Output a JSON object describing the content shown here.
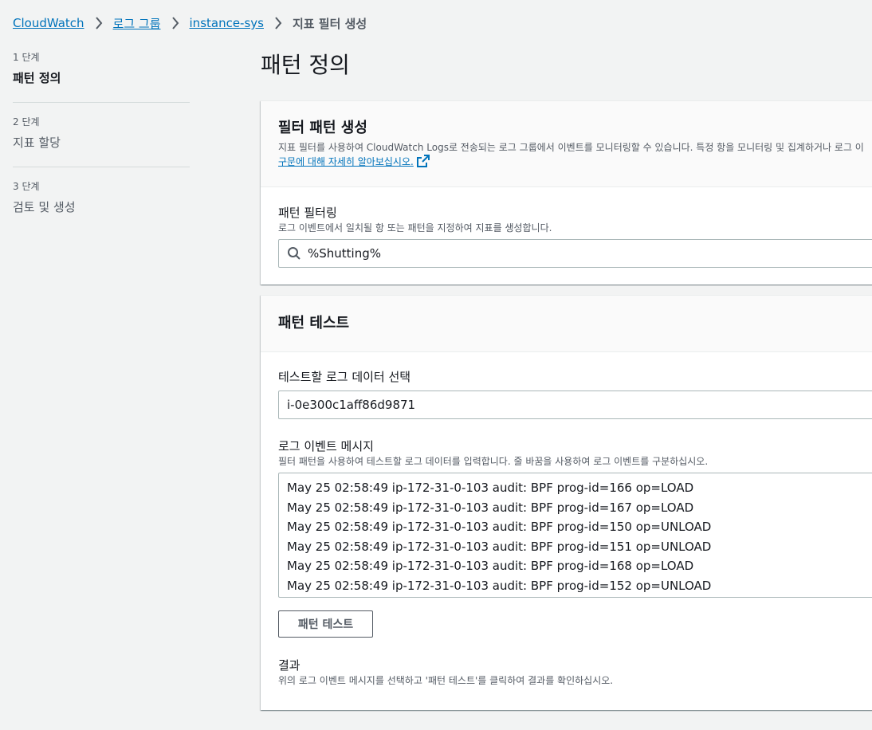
{
  "breadcrumb": {
    "items": [
      "CloudWatch",
      "로그 그룹",
      "instance-sys"
    ],
    "current": "지표 필터 생성"
  },
  "steps": [
    {
      "num": "1 단계",
      "label": "패턴 정의"
    },
    {
      "num": "2 단계",
      "label": "지표 할당"
    },
    {
      "num": "3 단계",
      "label": "검토 및 생성"
    }
  ],
  "page_title": "패턴 정의",
  "filter_panel": {
    "title": "필터 패턴 생성",
    "description": "지표 필터를 사용하여 CloudWatch Logs로 전송되는 로그 그룹에서 이벤트를 모니터링할 수 있습니다. 특정 항을 모니터링 및 집계하거나 로그 이",
    "link_text": "구문에 대해 자세히 알아보십시오.",
    "pattern_label": "패턴 필터링",
    "pattern_desc": "로그 이벤트에서 일치될 항 또는 패턴을 지정하여 지표를 생성합니다.",
    "pattern_value": "%Shutting%"
  },
  "test_panel": {
    "title": "패턴 테스트",
    "select_label": "테스트할 로그 데이터 선택",
    "select_value": "i-0e300c1aff86d9871",
    "messages_label": "로그 이벤트 메시지",
    "messages_desc": "필터 패턴을 사용하여 테스트할 로그 데이터를 입력합니다. 줄 바꿈을 사용하여 로그 이벤트를 구분하십시오.",
    "messages": [
      "May 25 02:58:49 ip-172-31-0-103 audit: BPF prog-id=166 op=LOAD",
      "May 25 02:58:49 ip-172-31-0-103 audit: BPF prog-id=167 op=LOAD",
      "May 25 02:58:49 ip-172-31-0-103 audit: BPF prog-id=150 op=UNLOAD",
      "May 25 02:58:49 ip-172-31-0-103 audit: BPF prog-id=151 op=UNLOAD",
      "May 25 02:58:49 ip-172-31-0-103 audit: BPF prog-id=168 op=LOAD",
      "May 25 02:58:49 ip-172-31-0-103 audit: BPF prog-id=152 op=UNLOAD"
    ],
    "test_button": "패턴 테스트",
    "results_label": "결과",
    "results_desc": "위의 로그 이벤트 메시지를 선택하고 '패턴 테스트'를 클릭하여 결과를 확인하십시오."
  },
  "icons": {
    "separator": "chevron-right-icon",
    "search": "search-icon",
    "external": "external-link-icon"
  },
  "colors": {
    "link": "#0073bb",
    "background": "#f2f3f3"
  }
}
